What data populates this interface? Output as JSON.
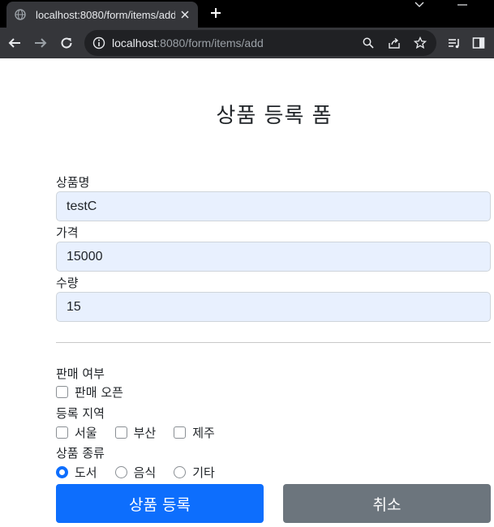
{
  "browser": {
    "tab_title": "localhost:8080/form/items/add",
    "url_host": "localhost",
    "url_rest": ":8080/form/items/add"
  },
  "page": {
    "title": "상품 등록 폼"
  },
  "form": {
    "item_name": {
      "label": "상품명",
      "value": "testC"
    },
    "price": {
      "label": "가격",
      "value": "15000"
    },
    "quantity": {
      "label": "수량",
      "value": "15"
    },
    "open": {
      "label": "판매 여부",
      "option_label": "판매 오픈",
      "checked": false
    },
    "regions": {
      "label": "등록 지역",
      "options": [
        {
          "label": "서울",
          "checked": false
        },
        {
          "label": "부산",
          "checked": false
        },
        {
          "label": "제주",
          "checked": false
        }
      ]
    },
    "item_type": {
      "label": "상품 종류",
      "options": [
        {
          "label": "도서",
          "checked": true
        },
        {
          "label": "음식",
          "checked": false
        },
        {
          "label": "기타",
          "checked": false
        }
      ]
    },
    "submit_label": "상품 등록",
    "cancel_label": "취소"
  },
  "colors": {
    "primary": "#0d6efd",
    "secondary": "#6c757d",
    "autofill": "#e8f0fe"
  }
}
